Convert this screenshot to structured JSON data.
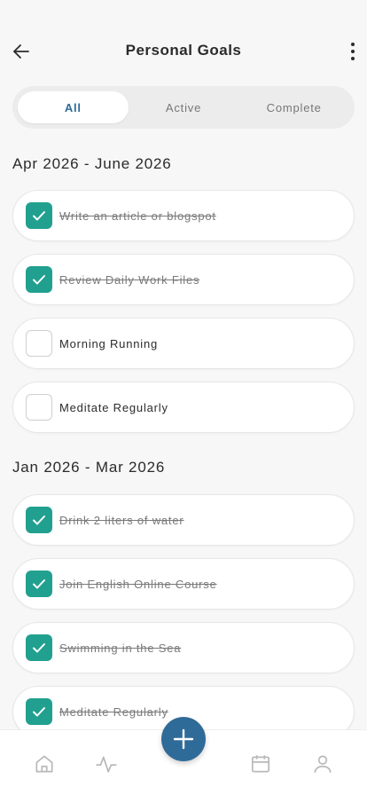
{
  "header": {
    "title": "Personal Goals"
  },
  "tabs": [
    {
      "label": "All",
      "active": true
    },
    {
      "label": "Active",
      "active": false
    },
    {
      "label": "Complete",
      "active": false
    }
  ],
  "sections": [
    {
      "title": "Apr 2026 - June 2026",
      "goals": [
        {
          "text": "Write an article or blogspot",
          "done": true
        },
        {
          "text": "Review Daily Work Files",
          "done": true
        },
        {
          "text": "Morning Running",
          "done": false
        },
        {
          "text": "Meditate Regularly",
          "done": false
        }
      ]
    },
    {
      "title": "Jan 2026 - Mar 2026",
      "goals": [
        {
          "text": "Drink 2 liters of water",
          "done": true
        },
        {
          "text": "Join English Online Course",
          "done": true
        },
        {
          "text": "Swimming in the Sea",
          "done": true
        },
        {
          "text": "Meditate Regularly",
          "done": true
        }
      ]
    }
  ],
  "icons": {
    "back": "arrow-left-icon",
    "more": "more-vertical-icon",
    "check": "checkmark-icon",
    "home": "home-icon",
    "activity": "activity-icon",
    "add": "plus-icon",
    "calendar": "calendar-icon",
    "profile": "user-icon"
  },
  "colors": {
    "accent": "#2f6b98",
    "check": "#21a08f",
    "background": "#f7f7f7"
  }
}
